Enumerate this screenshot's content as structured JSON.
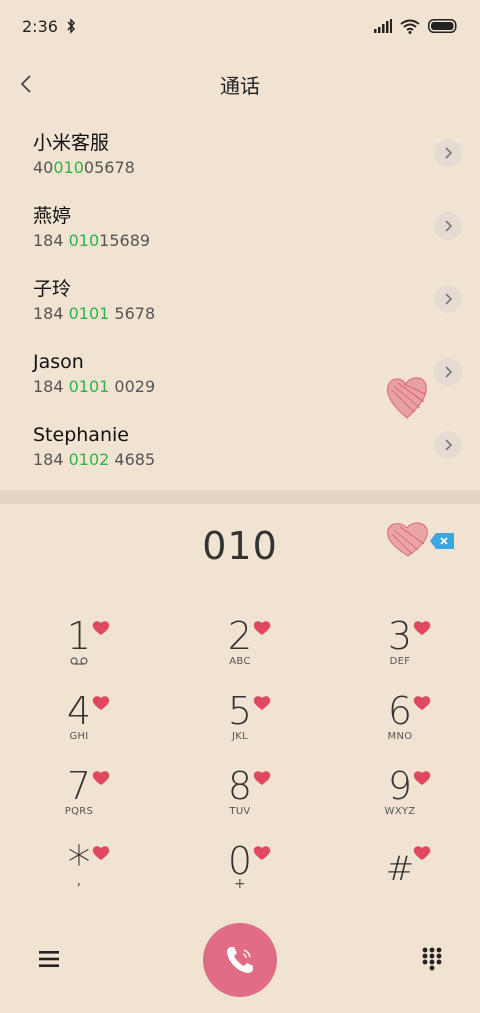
{
  "status": {
    "time": "2:36"
  },
  "header": {
    "title": "通话"
  },
  "contacts": [
    {
      "name": "小米客服",
      "num_pre": "40",
      "num_hl": "010",
      "num_post": "05678"
    },
    {
      "name": "燕婷",
      "num_pre": "184 ",
      "num_hl": "010",
      "num_post": "15689"
    },
    {
      "name": "子玲",
      "num_pre": "184 ",
      "num_hl": "0101",
      "num_post": " 5678"
    },
    {
      "name": "Jason",
      "num_pre": "184 ",
      "num_hl": "0101",
      "num_post": " 0029"
    },
    {
      "name": "Stephanie",
      "num_pre": "184 ",
      "num_hl": "0102",
      "num_post": " 4685"
    }
  ],
  "dialer": {
    "entered": "010"
  },
  "keys": [
    {
      "digit": "1",
      "letters": ""
    },
    {
      "digit": "2",
      "letters": "ABC"
    },
    {
      "digit": "3",
      "letters": "DEF"
    },
    {
      "digit": "4",
      "letters": "GHI"
    },
    {
      "digit": "5",
      "letters": "JKL"
    },
    {
      "digit": "6",
      "letters": "MNO"
    },
    {
      "digit": "7",
      "letters": "PQRS"
    },
    {
      "digit": "8",
      "letters": "TUV"
    },
    {
      "digit": "9",
      "letters": "WXYZ"
    },
    {
      "digit": "*",
      "letters": ","
    },
    {
      "digit": "0",
      "letters": "+"
    },
    {
      "digit": "#",
      "letters": ""
    }
  ],
  "colors": {
    "accent_green": "#2db34a",
    "call_button": "#e06c86",
    "heart": "#e0485f"
  },
  "icons": [
    "bluetooth-icon",
    "signal-icon",
    "wifi-icon",
    "battery-icon",
    "back-icon",
    "chevron-right-icon",
    "heart-icon",
    "backspace-icon",
    "voicemail-icon",
    "menu-icon",
    "phone-icon",
    "keypad-icon"
  ]
}
